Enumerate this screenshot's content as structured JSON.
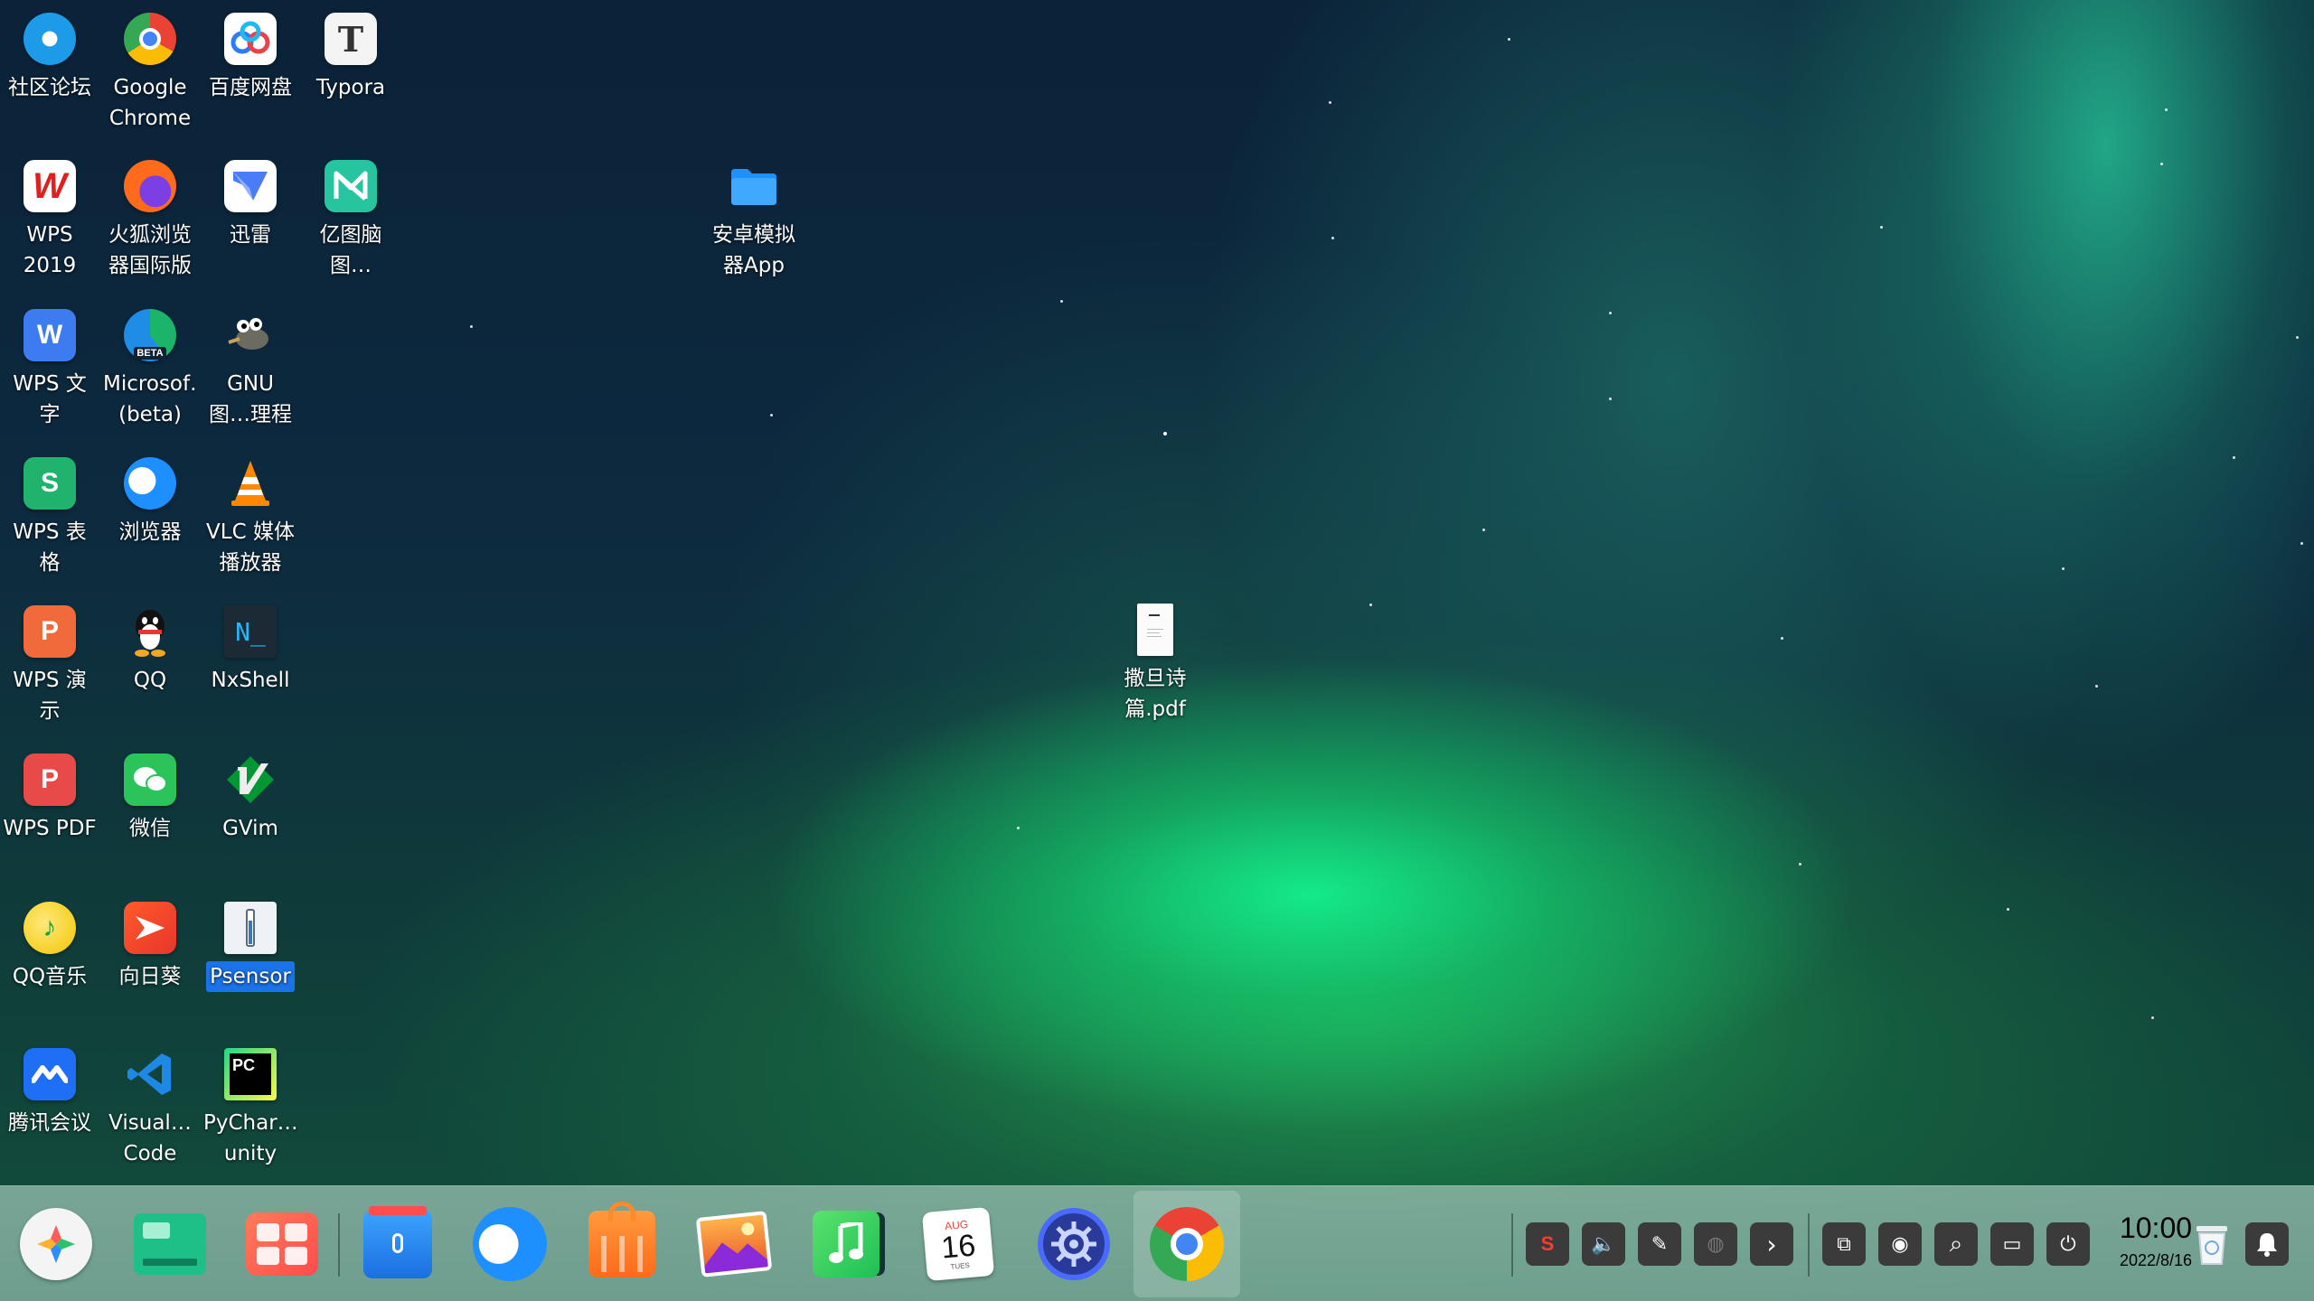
{
  "desktop": {
    "icons": [
      {
        "label": "社区论坛",
        "icon": "deepin-forum-icon"
      },
      {
        "label": "Google Chrome",
        "icon": "chrome-icon"
      },
      {
        "label": "百度网盘",
        "icon": "baidu-netdisk-icon"
      },
      {
        "label": "Typora",
        "icon": "typora-icon"
      },
      {
        "label": "WPS 2019",
        "icon": "wps-2019-icon"
      },
      {
        "label": "火狐浏览器国际版",
        "icon": "firefox-icon"
      },
      {
        "label": "迅雷",
        "icon": "xunlei-icon"
      },
      {
        "label": "亿图脑图…aster",
        "icon": "mindmaster-icon"
      },
      {
        "label": "安卓模拟器App",
        "icon": "folder-icon"
      },
      {
        "label": "WPS 文字",
        "icon": "wps-writer-icon"
      },
      {
        "label": "Microsof… (beta)",
        "icon": "edge-beta-icon"
      },
      {
        "label": "GNU 图…理程序",
        "icon": "gimp-icon"
      },
      {
        "label": "WPS 表格",
        "icon": "wps-spreadsheet-icon"
      },
      {
        "label": "浏览器",
        "icon": "deepin-browser-icon"
      },
      {
        "label": "VLC 媒体播放器",
        "icon": "vlc-icon"
      },
      {
        "label": "WPS 演示",
        "icon": "wps-presentation-icon"
      },
      {
        "label": "QQ",
        "icon": "qq-icon"
      },
      {
        "label": "NxShell",
        "icon": "nxshell-icon"
      },
      {
        "label": "撒旦诗篇.pdf",
        "icon": "pdf-file-icon"
      },
      {
        "label": "WPS PDF",
        "icon": "wps-pdf-icon"
      },
      {
        "label": "微信",
        "icon": "wechat-icon"
      },
      {
        "label": "GVim",
        "icon": "gvim-icon"
      },
      {
        "label": "QQ音乐",
        "icon": "qq-music-icon"
      },
      {
        "label": "向日葵",
        "icon": "sunlogin-icon"
      },
      {
        "label": "Psensor",
        "icon": "psensor-icon"
      },
      {
        "label": "腾讯会议",
        "icon": "tencent-meeting-icon"
      },
      {
        "label": "Visual… Code",
        "icon": "vscode-icon"
      },
      {
        "label": "PyChar…unity",
        "icon": "pycharm-icon"
      }
    ],
    "icon_glyphs": {
      "typora": "T",
      "wps_writer": "W",
      "wps_spreadsheet": "S",
      "wps_presentation": "P",
      "wps_pdf": "P",
      "nxshell": "N_",
      "pycharm": "PC"
    },
    "selected_icon": "Psensor"
  },
  "taskbar": {
    "dock": [
      {
        "name": "launcher",
        "icon": "launcher-icon"
      },
      {
        "name": "multitasking-view",
        "icon": "multitasking-icon"
      },
      {
        "name": "app-store",
        "icon": "app-grid-icon"
      },
      {
        "name": "file-manager",
        "icon": "folder-icon"
      },
      {
        "name": "browser",
        "icon": "deepin-browser-icon"
      },
      {
        "name": "app-store-bag",
        "icon": "shopping-bag-icon"
      },
      {
        "name": "image-viewer",
        "icon": "photo-icon"
      },
      {
        "name": "music",
        "icon": "music-note-icon"
      },
      {
        "name": "calendar",
        "icon": "calendar-icon"
      },
      {
        "name": "control-center",
        "icon": "gear-icon"
      },
      {
        "name": "google-chrome",
        "icon": "chrome-icon"
      }
    ],
    "calendar": {
      "month": "AUG",
      "day": "16",
      "weekday": "TUES"
    },
    "tray": [
      {
        "name": "sogou-input",
        "icon": "sogou-icon",
        "glyph": "S"
      },
      {
        "name": "volume",
        "icon": "speaker-icon",
        "glyph": "🔈"
      },
      {
        "name": "pen",
        "icon": "pen-icon",
        "glyph": "✎"
      },
      {
        "name": "mouse",
        "icon": "mouse-icon",
        "glyph": "◍"
      },
      {
        "name": "expand",
        "icon": "chevron-right-icon",
        "glyph": "›"
      },
      {
        "name": "screenshot",
        "icon": "screenshot-icon",
        "glyph": "⧉"
      },
      {
        "name": "network",
        "icon": "network-icon",
        "glyph": "◉"
      },
      {
        "name": "search",
        "icon": "search-icon",
        "glyph": "⌕"
      },
      {
        "name": "keyboard",
        "icon": "keyboard-icon",
        "glyph": "▭"
      },
      {
        "name": "power",
        "icon": "power-icon",
        "glyph": "⏻"
      }
    ],
    "clock": {
      "time": "10:00",
      "date": "2022/8/16"
    },
    "trash_icon": "trash-icon",
    "notification_icon": "bell-icon"
  }
}
